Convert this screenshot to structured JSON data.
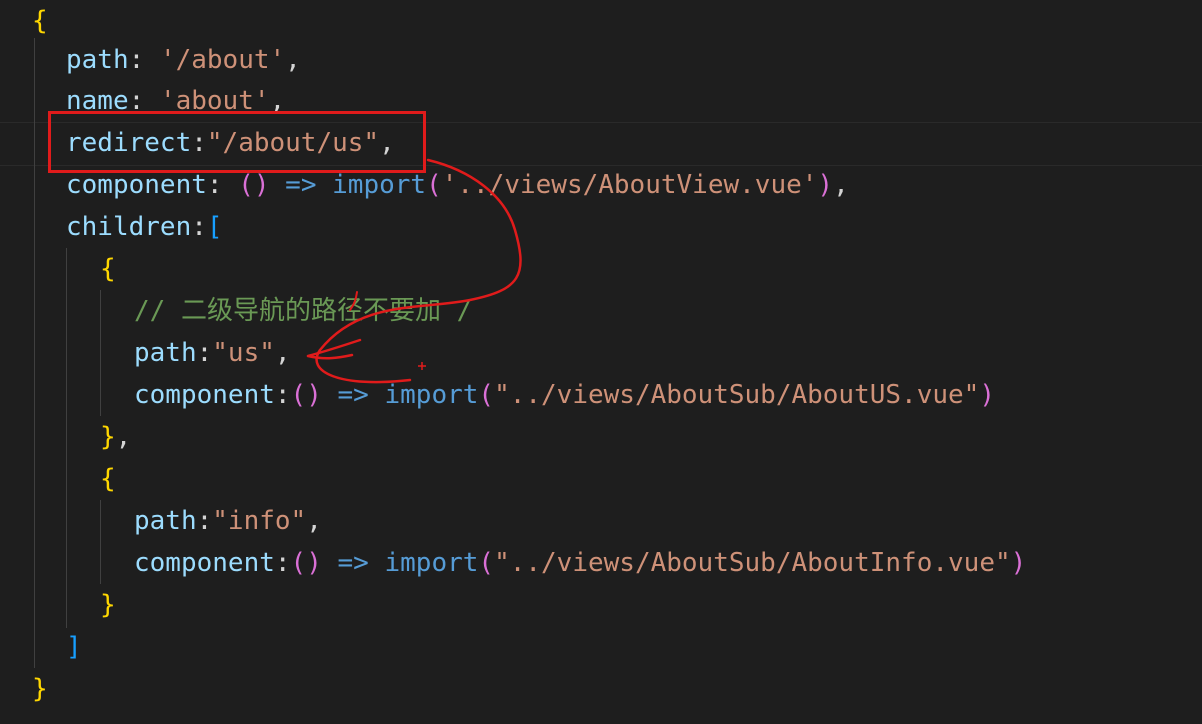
{
  "editor": {
    "lines": [
      {
        "id": "l1",
        "tokens": [
          {
            "t": "{",
            "c": "tok-br1"
          }
        ]
      },
      {
        "id": "l2",
        "tokens": [
          {
            "t": "path",
            "c": "tok-prop"
          },
          {
            "t": ": ",
            "c": "tok-punc"
          },
          {
            "t": "'/about'",
            "c": "tok-str"
          },
          {
            "t": ",",
            "c": "tok-punc"
          }
        ]
      },
      {
        "id": "l3",
        "tokens": [
          {
            "t": "name",
            "c": "tok-prop"
          },
          {
            "t": ": ",
            "c": "tok-punc"
          },
          {
            "t": "'about'",
            "c": "tok-str"
          },
          {
            "t": ",",
            "c": "tok-punc"
          }
        ]
      },
      {
        "id": "l4",
        "tokens": [
          {
            "t": "redirect",
            "c": "tok-prop"
          },
          {
            "t": ":",
            "c": "tok-punc"
          },
          {
            "t": "\"/about/us\"",
            "c": "tok-str"
          },
          {
            "t": ",",
            "c": "tok-punc"
          }
        ]
      },
      {
        "id": "l5",
        "tokens": [
          {
            "t": "component",
            "c": "tok-prop"
          },
          {
            "t": ": ",
            "c": "tok-punc"
          },
          {
            "t": "()",
            "c": "tok-br2"
          },
          {
            "t": " => ",
            "c": "tok-kw"
          },
          {
            "t": "import",
            "c": "tok-kw"
          },
          {
            "t": "(",
            "c": "tok-br2"
          },
          {
            "t": "'../views/AboutView.vue'",
            "c": "tok-str"
          },
          {
            "t": ")",
            "c": "tok-br2"
          },
          {
            "t": ",",
            "c": "tok-punc"
          }
        ]
      },
      {
        "id": "l6",
        "tokens": [
          {
            "t": "children",
            "c": "tok-prop"
          },
          {
            "t": ":",
            "c": "tok-punc"
          },
          {
            "t": "[",
            "c": "tok-br3"
          }
        ]
      },
      {
        "id": "l7",
        "tokens": [
          {
            "t": "{",
            "c": "tok-br1"
          }
        ]
      },
      {
        "id": "l8",
        "tokens": [
          {
            "t": "// 二级导航的路径不要加 /",
            "c": "tok-cmt"
          }
        ]
      },
      {
        "id": "l9",
        "tokens": [
          {
            "t": "path",
            "c": "tok-prop"
          },
          {
            "t": ":",
            "c": "tok-punc"
          },
          {
            "t": "\"us\"",
            "c": "tok-str"
          },
          {
            "t": ",",
            "c": "tok-punc"
          }
        ]
      },
      {
        "id": "l10",
        "tokens": [
          {
            "t": "component",
            "c": "tok-prop"
          },
          {
            "t": ":",
            "c": "tok-punc"
          },
          {
            "t": "()",
            "c": "tok-br2"
          },
          {
            "t": " => ",
            "c": "tok-kw"
          },
          {
            "t": "import",
            "c": "tok-kw"
          },
          {
            "t": "(",
            "c": "tok-br2"
          },
          {
            "t": "\"../views/AboutSub/AboutUS.vue\"",
            "c": "tok-str"
          },
          {
            "t": ")",
            "c": "tok-br2"
          }
        ]
      },
      {
        "id": "l11",
        "tokens": [
          {
            "t": "}",
            "c": "tok-br1"
          },
          {
            "t": ",",
            "c": "tok-punc"
          }
        ]
      },
      {
        "id": "l12",
        "tokens": [
          {
            "t": "{",
            "c": "tok-br1"
          }
        ]
      },
      {
        "id": "l13",
        "tokens": [
          {
            "t": "path",
            "c": "tok-prop"
          },
          {
            "t": ":",
            "c": "tok-punc"
          },
          {
            "t": "\"info\"",
            "c": "tok-str"
          },
          {
            "t": ",",
            "c": "tok-punc"
          }
        ]
      },
      {
        "id": "l14",
        "tokens": [
          {
            "t": "component",
            "c": "tok-prop"
          },
          {
            "t": ":",
            "c": "tok-punc"
          },
          {
            "t": "()",
            "c": "tok-br2"
          },
          {
            "t": " => ",
            "c": "tok-kw"
          },
          {
            "t": "import",
            "c": "tok-kw"
          },
          {
            "t": "(",
            "c": "tok-br2"
          },
          {
            "t": "\"../views/AboutSub/AboutInfo.vue\"",
            "c": "tok-str"
          },
          {
            "t": ")",
            "c": "tok-br2"
          }
        ]
      },
      {
        "id": "l15",
        "tokens": [
          {
            "t": "}",
            "c": "tok-br1"
          }
        ]
      },
      {
        "id": "l16",
        "tokens": [
          {
            "t": "]",
            "c": "tok-br3"
          }
        ]
      },
      {
        "id": "l17",
        "tokens": [
          {
            "t": "}",
            "c": "tok-br1"
          }
        ]
      }
    ]
  },
  "colors": {
    "background": "#1e1e1e",
    "property": "#9cdcfe",
    "string": "#ce9178",
    "keyword": "#569cd6",
    "bracket_level1": "#ffd700",
    "bracket_level2": "#da70d6",
    "bracket_level3": "#179fff",
    "comment": "#6a9955",
    "annotation": "#e01b1b"
  }
}
